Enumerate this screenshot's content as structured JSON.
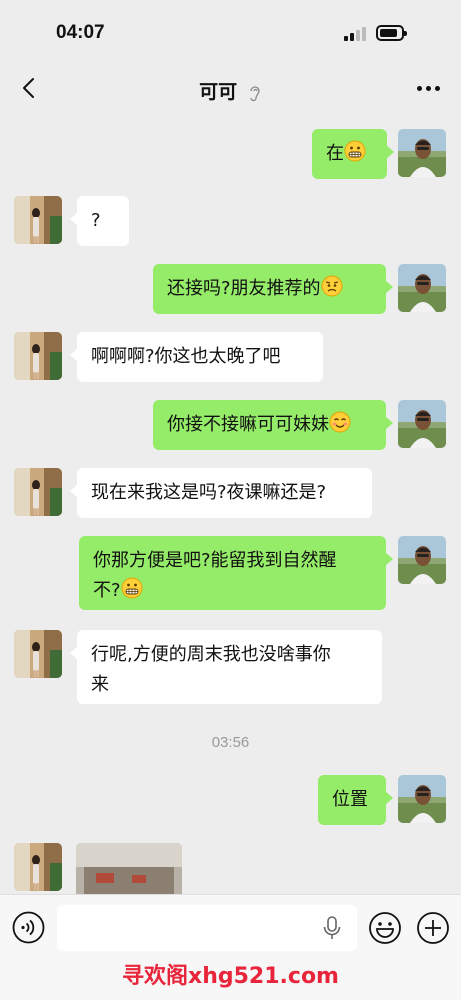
{
  "status_bar": {
    "time": "04:07",
    "signal_icon": "signal-icon",
    "battery_icon": "battery-icon"
  },
  "nav": {
    "title": "可可",
    "back_icon": "back-icon",
    "ear_icon": "ear-icon",
    "more_icon": "more-icon"
  },
  "messages": [
    {
      "from": "me",
      "text": "在",
      "emoji": "grimace"
    },
    {
      "from": "them",
      "text": "?"
    },
    {
      "from": "me",
      "text": "还接吗?朋友推荐的",
      "emoji": "worried"
    },
    {
      "from": "them",
      "text": "啊啊啊?你这也太晚了吧"
    },
    {
      "from": "me",
      "text": "你接不接嘛可可妹妹",
      "emoji": "smirk"
    },
    {
      "from": "them",
      "text": "现在来我这是吗?夜课嘛还是?"
    },
    {
      "from": "me",
      "line1": "你那方便是吧?能留我到自然醒",
      "line2": "不?",
      "emoji": "grimace"
    },
    {
      "from": "them",
      "line1": "行呢,方便的周末我也没啥事你",
      "line2": "来"
    },
    {
      "from": "me",
      "text": "位置"
    },
    {
      "from": "them",
      "type": "image"
    }
  ],
  "timestamp": "03:56",
  "input_bar": {
    "voice_icon": "voice-icon",
    "mic_icon": "mic-icon",
    "emoji_icon": "emoji-icon",
    "plus_icon": "plus-icon"
  },
  "watermark": "寻欢阁xhg521.com",
  "colors": {
    "background": "#ededed",
    "my_bubble": "#95ec69",
    "their_bubble": "#ffffff",
    "watermark": "#e8253a"
  }
}
